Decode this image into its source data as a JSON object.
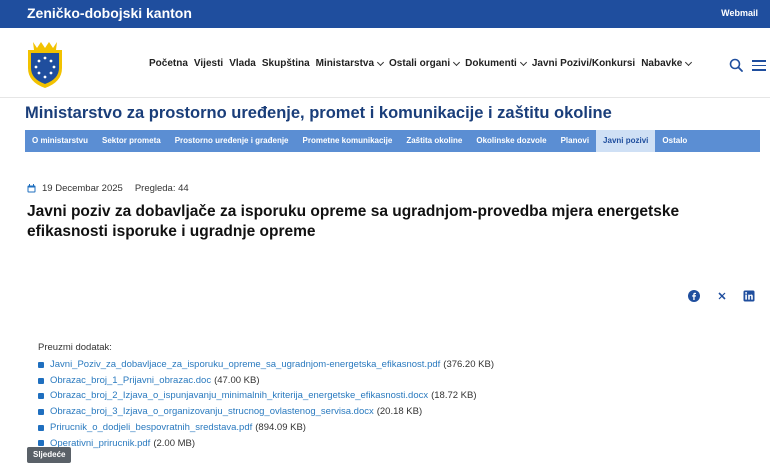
{
  "topbar": {
    "brand": "Zeničko-dobojski kanton",
    "webmail": "Webmail"
  },
  "nav": {
    "items": [
      {
        "label": "Početna",
        "dropdown": false
      },
      {
        "label": "Vijesti",
        "dropdown": false
      },
      {
        "label": "Vlada",
        "dropdown": false
      },
      {
        "label": "Skupština",
        "dropdown": false
      },
      {
        "label": "Ministarstva",
        "dropdown": true
      },
      {
        "label": "Ostali organi",
        "dropdown": true
      },
      {
        "label": "Dokumenti",
        "dropdown": true
      },
      {
        "label": "Javni Pozivi/Konkursi",
        "dropdown": false
      },
      {
        "label": "Nabavke",
        "dropdown": true
      }
    ]
  },
  "ministry_title": "Ministarstvo za prostorno uređenje, promet i komunikacije i zaštitu okoline",
  "subnav": {
    "items": [
      "O ministarstvu",
      "Sektor prometa",
      "Prostorno uređenje i građenje",
      "Prometne komunikacije",
      "Zaštita okoline",
      "Okolinske dozvole",
      "Planovi",
      "Javni pozivi",
      "Ostalo"
    ],
    "active": "Javni pozivi"
  },
  "article": {
    "date": "19 Decembar 2025",
    "views": "Pregleda: 44",
    "title": "Javni poziv za dobavljače za isporuku opreme sa ugradnjom-provedba mjera energetske efikasnosti isporuke i ugradnje opreme"
  },
  "downloads": {
    "label": "Preuzmi dodatak:",
    "files": [
      {
        "name": "Javni_Poziv_za_dobavljace_za_isporuku_opreme_sa_ugradnjom-energetska_efikasnost.pdf",
        "size": "(376.20 KB)"
      },
      {
        "name": "Obrazac_broj_1_Prijavni_obrazac.doc",
        "size": "(47.00 KB)"
      },
      {
        "name": "Obrazac_broj_2_Izjava_o_ispunjavanju_minimalnih_kriterija_energetske_efikasnosti.docx",
        "size": "(18.72 KB)"
      },
      {
        "name": "Obrazac_broj_3_Izjava_o_organizovanju_strucnog_ovlastenog_servisa.docx",
        "size": "(20.18 KB)"
      },
      {
        "name": "Prirucnik_o_dodjeli_bespovratnih_sredstava.pdf",
        "size": "(894.09 KB)"
      },
      {
        "name": "Operativni_prirucnik.pdf",
        "size": "(2.00 MB)"
      }
    ]
  },
  "next_button": "Sljedeće",
  "icons": {
    "calendar": "calendar-icon",
    "search": "search-icon",
    "menu": "menu-icon",
    "facebook": "facebook-icon",
    "x": "x-icon",
    "linkedin": "linkedin-icon"
  },
  "colors": {
    "brand_blue": "#1f4e9e",
    "subnav_blue": "#5b8ed3",
    "active_tab": "#cfe0f5",
    "link": "#2a7abf",
    "logo_yellow": "#f2c200"
  }
}
